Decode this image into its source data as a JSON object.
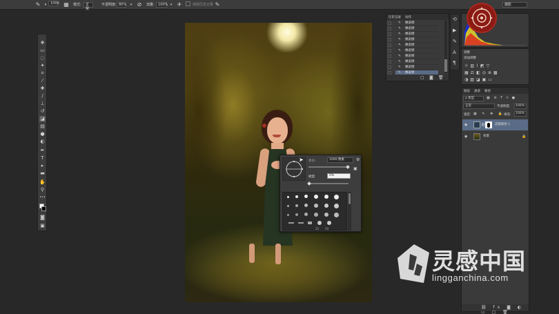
{
  "options_bar": {
    "brush_size": "1000",
    "mode_label": "模式:",
    "mode_value": "正常",
    "opacity_label": "不透明度:",
    "opacity_value": "80%",
    "flow_label": "流量:",
    "flow_value": "100%",
    "sample_label": "抹除历史记录",
    "workspace_value": "摄影"
  },
  "history_panel": {
    "tabs": [
      "历史记录",
      "动作"
    ],
    "items": [
      "橡皮擦",
      "橡皮擦",
      "橡皮擦",
      "橡皮擦",
      "橡皮擦",
      "橡皮擦",
      "橡皮擦",
      "橡皮擦",
      "橡皮擦",
      "橡皮擦"
    ]
  },
  "adjustments_panel": {
    "tab": "调整",
    "subtitle": "添加调整"
  },
  "layers_panel": {
    "tabs": [
      "图层",
      "通道",
      "路径"
    ],
    "kind_filter": "ρ 类型",
    "blend_mode": "正常",
    "opacity_label": "不透明度:",
    "opacity_value": "100%",
    "lock_label": "锁定:",
    "fill_label": "填充:",
    "fill_value": "100%",
    "layers": [
      {
        "name": "选取颜色 1",
        "selected": true
      },
      {
        "name": "背景",
        "selected": false
      }
    ]
  },
  "brush_popup": {
    "size_label": "大小:",
    "size_value": "1000 像素",
    "hardness_label": "硬度:",
    "hardness_value": "0%",
    "preset_sizes": [
      "25",
      "50"
    ]
  },
  "watermark": {
    "brand": "灵感中国",
    "url": "lingganchina.com"
  },
  "colors": {
    "ui_bg": "#282828",
    "panel_bg": "#3a3a3a",
    "selected_row": "#5a6b86",
    "watermark": "#ffffff"
  }
}
